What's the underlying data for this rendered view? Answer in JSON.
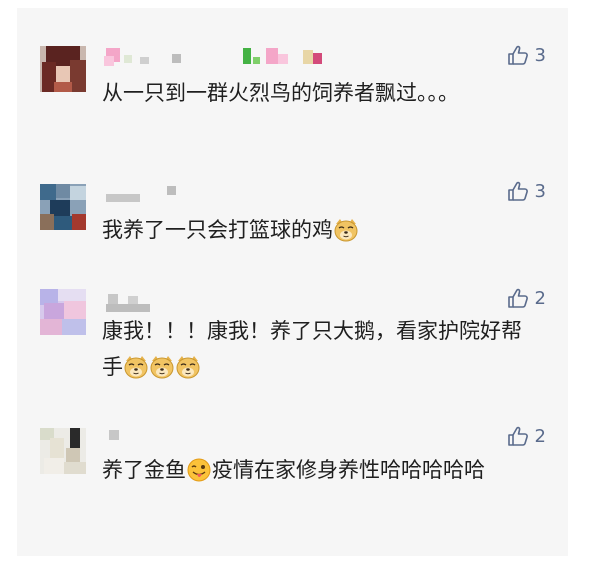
{
  "comments": [
    {
      "likes": "3",
      "segments": [
        {
          "type": "text",
          "value": "从一只到一群火烈鸟的饲养者飘过。。。"
        }
      ]
    },
    {
      "likes": "3",
      "segments": [
        {
          "type": "text",
          "value": "我养了一只会打篮球的鸡"
        },
        {
          "type": "emoji",
          "name": "doge"
        }
      ]
    },
    {
      "likes": "2",
      "segments": [
        {
          "type": "text",
          "value": "康我！！！康我！养了只大鹅，看家护院好帮手"
        },
        {
          "type": "emoji",
          "name": "doge"
        },
        {
          "type": "emoji",
          "name": "doge"
        },
        {
          "type": "emoji",
          "name": "doge"
        }
      ]
    },
    {
      "likes": "2",
      "segments": [
        {
          "type": "text",
          "value": "养了金鱼"
        },
        {
          "type": "emoji",
          "name": "tongue-wink"
        },
        {
          "type": "text",
          "value": "疫情在家修身养性哈哈哈哈哈"
        }
      ]
    }
  ],
  "colors": {
    "panel_bg": "#f6f6f6",
    "like_color": "#5a6b8c",
    "text_color": "#1f1f1f"
  }
}
